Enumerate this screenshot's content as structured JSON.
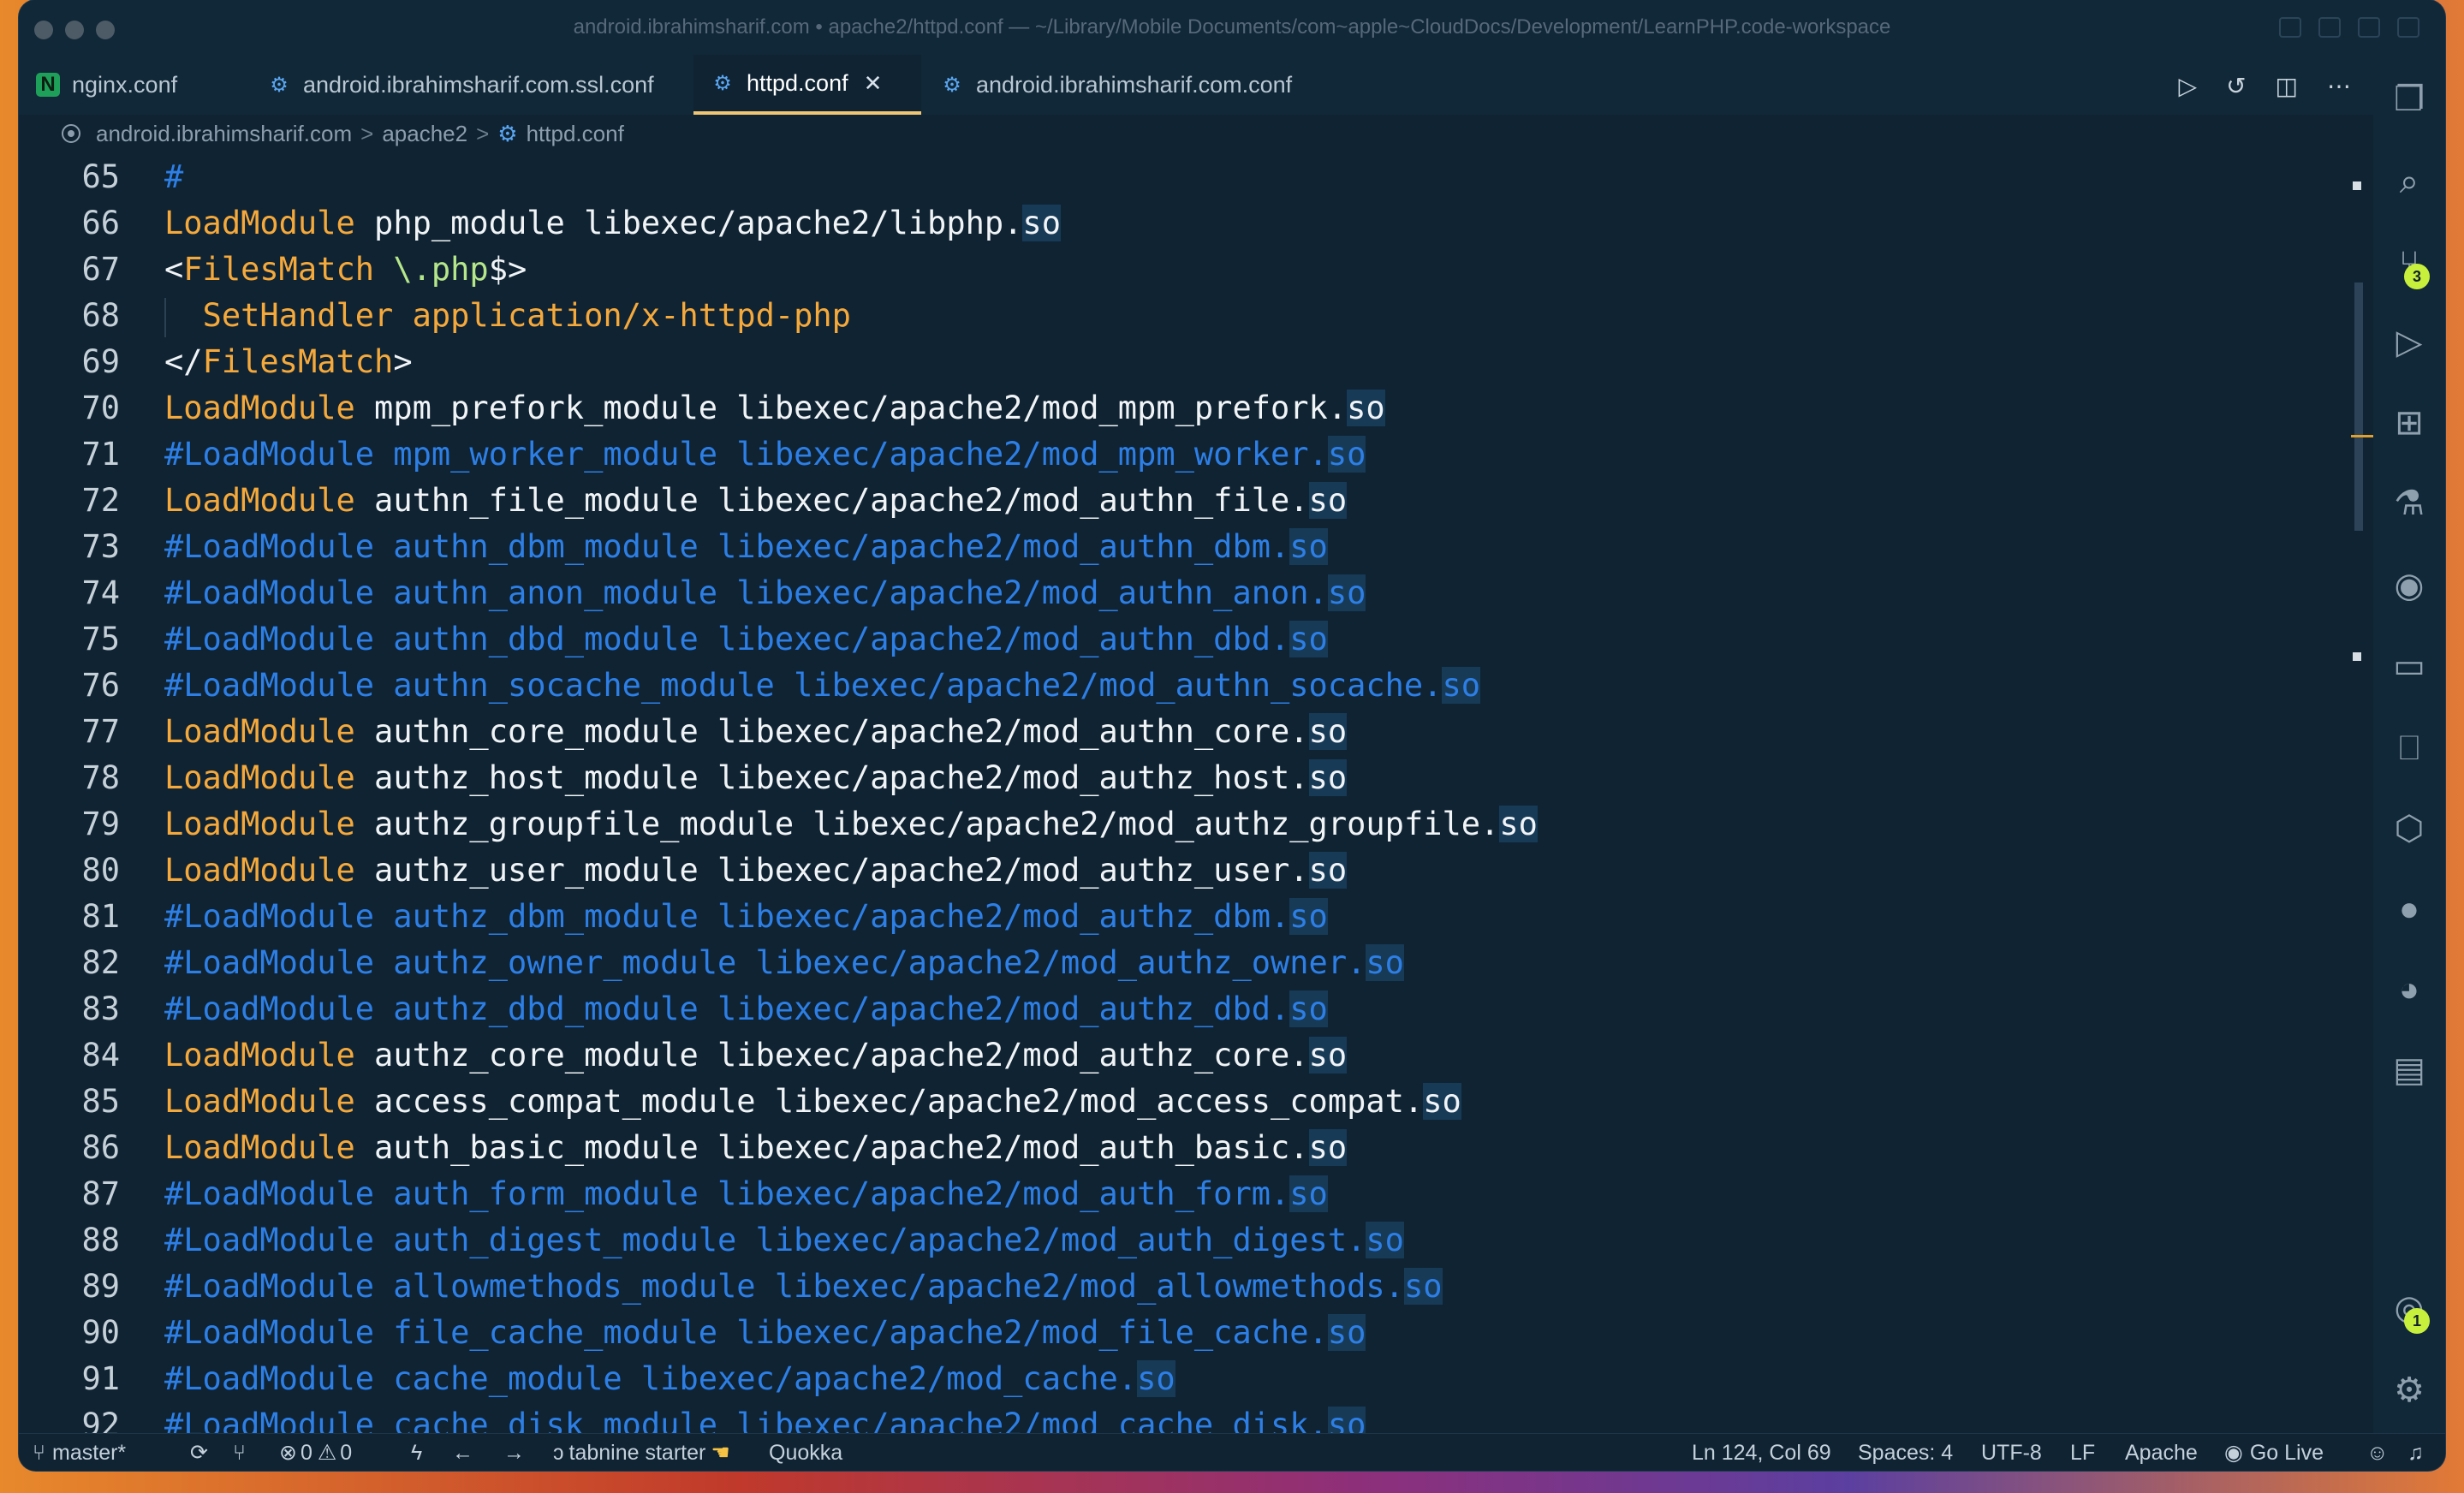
{
  "window": {
    "title": "android.ibrahimsharif.com • apache2/httpd.conf — ~/Library/Mobile Documents/com~apple~CloudDocs/Development/LearnPHP.code-workspace"
  },
  "tabs": [
    {
      "label": "nginx.conf",
      "icon": "nginx-icon"
    },
    {
      "label": "android.ibrahimsharif.com.ssl.conf",
      "icon": "gear-icon"
    },
    {
      "label": "httpd.conf",
      "icon": "gear-icon",
      "active": true
    },
    {
      "label": "android.ibrahimsharif.com.conf",
      "icon": "gear-icon"
    }
  ],
  "breadcrumb": {
    "parts": [
      "android.ibrahimsharif.com",
      "apache2",
      "httpd.conf"
    ],
    "sep": ">"
  },
  "lines": [
    {
      "n": "65",
      "t": "#"
    },
    {
      "n": "66",
      "t": "LoadModule php_module libexec/apache2/libphp.so"
    },
    {
      "n": "67",
      "t": "<FilesMatch \\.php$>"
    },
    {
      "n": "68",
      "t": "  SetHandler application/x-httpd-php"
    },
    {
      "n": "69",
      "t": "</FilesMatch>"
    },
    {
      "n": "70",
      "t": "LoadModule mpm_prefork_module libexec/apache2/mod_mpm_prefork.so"
    },
    {
      "n": "71",
      "t": "#LoadModule mpm_worker_module libexec/apache2/mod_mpm_worker.so"
    },
    {
      "n": "72",
      "t": "LoadModule authn_file_module libexec/apache2/mod_authn_file.so"
    },
    {
      "n": "73",
      "t": "#LoadModule authn_dbm_module libexec/apache2/mod_authn_dbm.so"
    },
    {
      "n": "74",
      "t": "#LoadModule authn_anon_module libexec/apache2/mod_authn_anon.so"
    },
    {
      "n": "75",
      "t": "#LoadModule authn_dbd_module libexec/apache2/mod_authn_dbd.so"
    },
    {
      "n": "76",
      "t": "#LoadModule authn_socache_module libexec/apache2/mod_authn_socache.so"
    },
    {
      "n": "77",
      "t": "LoadModule authn_core_module libexec/apache2/mod_authn_core.so"
    },
    {
      "n": "78",
      "t": "LoadModule authz_host_module libexec/apache2/mod_authz_host.so"
    },
    {
      "n": "79",
      "t": "LoadModule authz_groupfile_module libexec/apache2/mod_authz_groupfile.so"
    },
    {
      "n": "80",
      "t": "LoadModule authz_user_module libexec/apache2/mod_authz_user.so"
    },
    {
      "n": "81",
      "t": "#LoadModule authz_dbm_module libexec/apache2/mod_authz_dbm.so"
    },
    {
      "n": "82",
      "t": "#LoadModule authz_owner_module libexec/apache2/mod_authz_owner.so"
    },
    {
      "n": "83",
      "t": "#LoadModule authz_dbd_module libexec/apache2/mod_authz_dbd.so"
    },
    {
      "n": "84",
      "t": "LoadModule authz_core_module libexec/apache2/mod_authz_core.so"
    },
    {
      "n": "85",
      "t": "LoadModule access_compat_module libexec/apache2/mod_access_compat.so"
    },
    {
      "n": "86",
      "t": "LoadModule auth_basic_module libexec/apache2/mod_auth_basic.so"
    },
    {
      "n": "87",
      "t": "#LoadModule auth_form_module libexec/apache2/mod_auth_form.so"
    },
    {
      "n": "88",
      "t": "#LoadModule auth_digest_module libexec/apache2/mod_auth_digest.so"
    },
    {
      "n": "89",
      "t": "#LoadModule allowmethods_module libexec/apache2/mod_allowmethods.so"
    },
    {
      "n": "90",
      "t": "#LoadModule file_cache_module libexec/apache2/mod_file_cache.so"
    },
    {
      "n": "91",
      "t": "#LoadModule cache_module libexec/apache2/mod_cache.so"
    },
    {
      "n": "92",
      "t": "#LoadModule cache_disk_module libexec/apache2/mod_cache_disk.so"
    }
  ],
  "activity": {
    "source_control_badge": "3",
    "accounts_badge": "1"
  },
  "status": {
    "branch": "master*",
    "errors": "0",
    "warnings": "0",
    "tabnine": "tabnine starter",
    "quokka": "Quokka",
    "position": "Ln 124, Col 69",
    "spaces": "Spaces: 4",
    "encoding": "UTF-8",
    "eol": "LF",
    "language": "Apache",
    "golive": "Go Live"
  },
  "colors": {
    "keyword": "#f6a93b",
    "comment": "#2d7fe6",
    "text": "#f1f4f6",
    "badge": "#c7f03c",
    "active_tab_border": "#f0c674"
  }
}
